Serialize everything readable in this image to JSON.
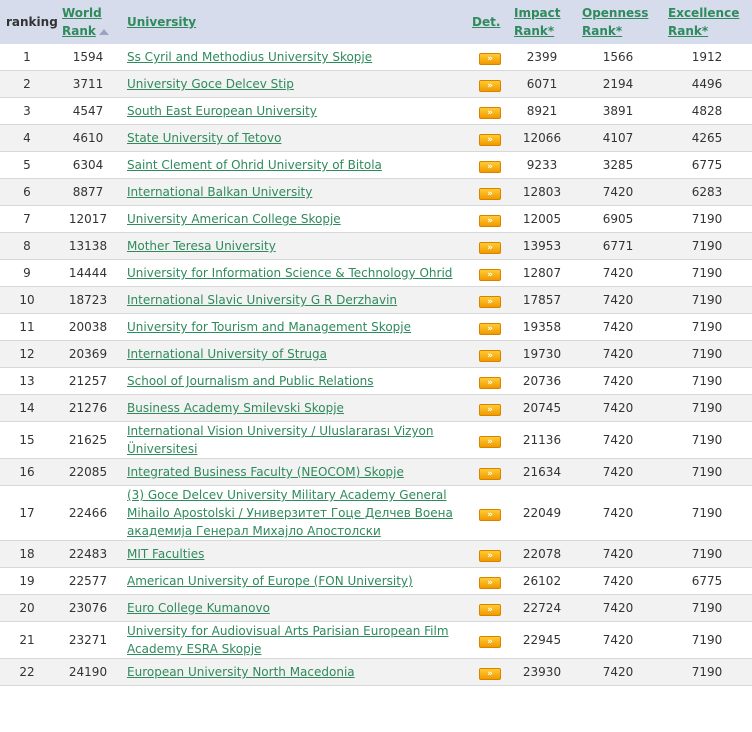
{
  "headers": {
    "ranking": "ranking",
    "world_rank_line1": "World",
    "world_rank_line2": "Rank",
    "university": "University",
    "det": "Det.",
    "impact_line1": "Impact",
    "impact_line2": "Rank*",
    "openness_line1": "Openness",
    "openness_line2": "Rank*",
    "excellence_line1": "Excellence",
    "excellence_line2": "Rank*"
  },
  "icons": {
    "det": "double-chevron-right-icon",
    "sort": "sort-ascending-icon"
  },
  "colors": {
    "header_bg": "#d6dcec",
    "link": "#2f8a5c",
    "det_button": "#f5a300"
  },
  "rows": [
    {
      "ranking": "1",
      "world": "1594",
      "name": "Ss Cyril and Methodius University Skopje",
      "impact": "2399",
      "openness": "1566",
      "excellence": "1912"
    },
    {
      "ranking": "2",
      "world": "3711",
      "name": "University Goce Delcev Stip",
      "impact": "6071",
      "openness": "2194",
      "excellence": "4496"
    },
    {
      "ranking": "3",
      "world": "4547",
      "name": "South East European University",
      "impact": "8921",
      "openness": "3891",
      "excellence": "4828"
    },
    {
      "ranking": "4",
      "world": "4610",
      "name": "State University of Tetovo",
      "impact": "12066",
      "openness": "4107",
      "excellence": "4265"
    },
    {
      "ranking": "5",
      "world": "6304",
      "name": "Saint Clement of Ohrid University of Bitola",
      "impact": "9233",
      "openness": "3285",
      "excellence": "6775"
    },
    {
      "ranking": "6",
      "world": "8877",
      "name": "International Balkan University",
      "impact": "12803",
      "openness": "7420",
      "excellence": "6283"
    },
    {
      "ranking": "7",
      "world": "12017",
      "name": "University American College Skopje",
      "impact": "12005",
      "openness": "6905",
      "excellence": "7190"
    },
    {
      "ranking": "8",
      "world": "13138",
      "name": "Mother Teresa University",
      "impact": "13953",
      "openness": "6771",
      "excellence": "7190"
    },
    {
      "ranking": "9",
      "world": "14444",
      "name": "University for Information Science & Technology Ohrid",
      "impact": "12807",
      "openness": "7420",
      "excellence": "7190"
    },
    {
      "ranking": "10",
      "world": "18723",
      "name": "International Slavic University G R Derzhavin",
      "impact": "17857",
      "openness": "7420",
      "excellence": "7190"
    },
    {
      "ranking": "11",
      "world": "20038",
      "name": "University for Tourism and Management Skopje",
      "impact": "19358",
      "openness": "7420",
      "excellence": "7190"
    },
    {
      "ranking": "12",
      "world": "20369",
      "name": "International University of Struga",
      "impact": "19730",
      "openness": "7420",
      "excellence": "7190"
    },
    {
      "ranking": "13",
      "world": "21257",
      "name": "School of Journalism and Public Relations",
      "impact": "20736",
      "openness": "7420",
      "excellence": "7190"
    },
    {
      "ranking": "14",
      "world": "21276",
      "name": "Business Academy Smilevski Skopje",
      "impact": "20745",
      "openness": "7420",
      "excellence": "7190"
    },
    {
      "ranking": "15",
      "world": "21625",
      "name": "International Vision University / Uluslararası Vizyon Üniversitesi",
      "impact": "21136",
      "openness": "7420",
      "excellence": "7190"
    },
    {
      "ranking": "16",
      "world": "22085",
      "name": "Integrated Business Faculty (NEOCOM) Skopje",
      "impact": "21634",
      "openness": "7420",
      "excellence": "7190"
    },
    {
      "ranking": "17",
      "world": "22466",
      "name": "(3) Goce Delcev University Military Academy General Mihailo Apostolski / Универзитет Гоце Делчев Воена академија Генерал Михајло Апостолски",
      "impact": "22049",
      "openness": "7420",
      "excellence": "7190"
    },
    {
      "ranking": "18",
      "world": "22483",
      "name": "MIT Faculties",
      "impact": "22078",
      "openness": "7420",
      "excellence": "7190"
    },
    {
      "ranking": "19",
      "world": "22577",
      "name": "American University of Europe (FON University)",
      "impact": "26102",
      "openness": "7420",
      "excellence": "6775"
    },
    {
      "ranking": "20",
      "world": "23076",
      "name": "Euro College Kumanovo",
      "impact": "22724",
      "openness": "7420",
      "excellence": "7190"
    },
    {
      "ranking": "21",
      "world": "23271",
      "name": "University for Audiovisual Arts Parisian European Film Academy ESRA Skopje",
      "impact": "22945",
      "openness": "7420",
      "excellence": "7190"
    },
    {
      "ranking": "22",
      "world": "24190",
      "name": "European University North Macedonia",
      "impact": "23930",
      "openness": "7420",
      "excellence": "7190"
    }
  ]
}
